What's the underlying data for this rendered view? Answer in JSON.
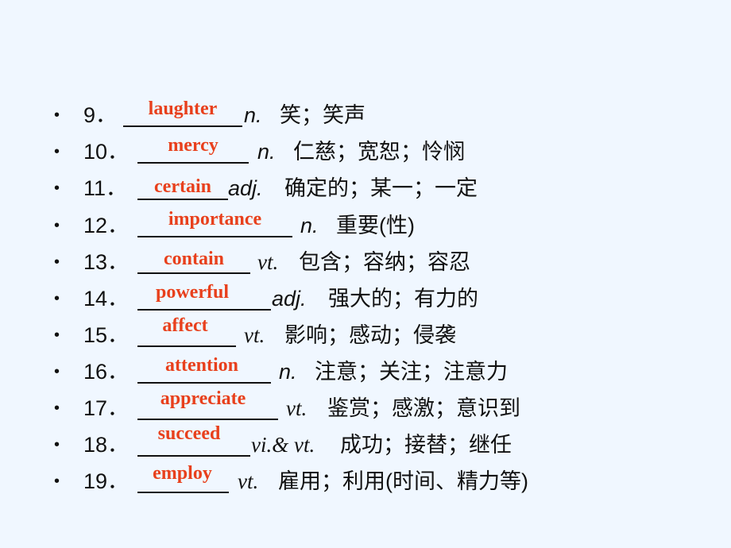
{
  "items": [
    {
      "number": "9．",
      "answer": "laughter",
      "pos": "n.",
      "meaning": "笑；笑声"
    },
    {
      "number": "10．",
      "answer": "mercy",
      "pos": "n.",
      "meaning": "仁慈；宽恕；怜悯"
    },
    {
      "number": "11．",
      "answer": "certain",
      "pos": "adj.",
      "meaning": "确定的；某一；一定"
    },
    {
      "number": "12．",
      "answer": "importance",
      "pos": "n.",
      "meaning": "重要(性)"
    },
    {
      "number": "13．",
      "answer": "contain",
      "pos": "vt.",
      "meaning": "包含；容纳；容忍"
    },
    {
      "number": "14．",
      "answer": "powerful",
      "pos": "adj.",
      "meaning": "强大的；有力的"
    },
    {
      "number": "15．",
      "answer": "affect",
      "pos": "vt.",
      "meaning": "影响；感动；侵袭"
    },
    {
      "number": "16．",
      "answer": "attention",
      "pos": "n.",
      "meaning": "注意；关注；注意力"
    },
    {
      "number": "17．",
      "answer": "appreciate",
      "pos": "vt.",
      "meaning": "鉴赏；感激；意识到"
    },
    {
      "number": "18．",
      "answer": "succeed",
      "pos": "vi.& vt.",
      "meaning": "成功；接替；继任"
    },
    {
      "number": "19．",
      "answer": "employ",
      "pos": "vt.",
      "meaning": "雇用；利用(时间、精力等)"
    }
  ],
  "bullet_symbol": "•",
  "colors": {
    "answer": "#e8401c",
    "background": "#f0f7ff",
    "text": "#111111"
  }
}
